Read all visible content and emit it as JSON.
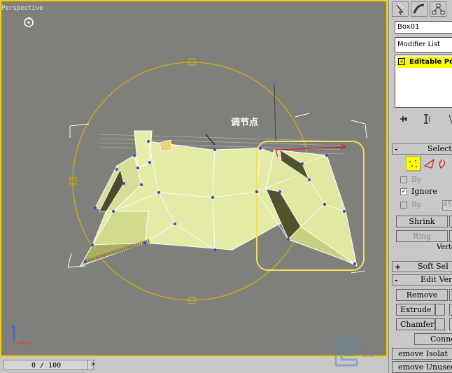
{
  "viewport": {
    "label": "Perspective",
    "callout": "调节点"
  },
  "timeline": {
    "frame_label": "0 / 100",
    "next_glyph": ">"
  },
  "panel": {
    "tabs": [
      "select-icon",
      "modify-icon",
      "hierarchy-icon"
    ],
    "object_name": "Box01",
    "modifier_list": "Modifier List",
    "stack_item": "Editable Po",
    "stack_plus": "+",
    "selection": {
      "title": "Select",
      "sign": "-",
      "by_vertex": "By",
      "ignore": "Ignore",
      "by_angle": "By",
      "angle_value": "45",
      "shrink": "Shrink",
      "ring": "Ring",
      "status": "Verte"
    },
    "soft_selection": {
      "title": "Soft Sel",
      "sign": "+"
    },
    "edit_vertices": {
      "title": "Edit Ver",
      "sign": "-",
      "remove": "Remove",
      "extrude": "Extrude",
      "chamfer": "Chamfer",
      "connect": "Conne",
      "remove_isolated": "emove Isolat",
      "remove_unused": "emove Unused"
    }
  },
  "colors": {
    "viewport_bg": "#7f7f7b",
    "active_border": "#f0d000",
    "vertex": "#3344ee",
    "mesh_face": "#e8eeaa",
    "gizmo": "#d8b000"
  }
}
